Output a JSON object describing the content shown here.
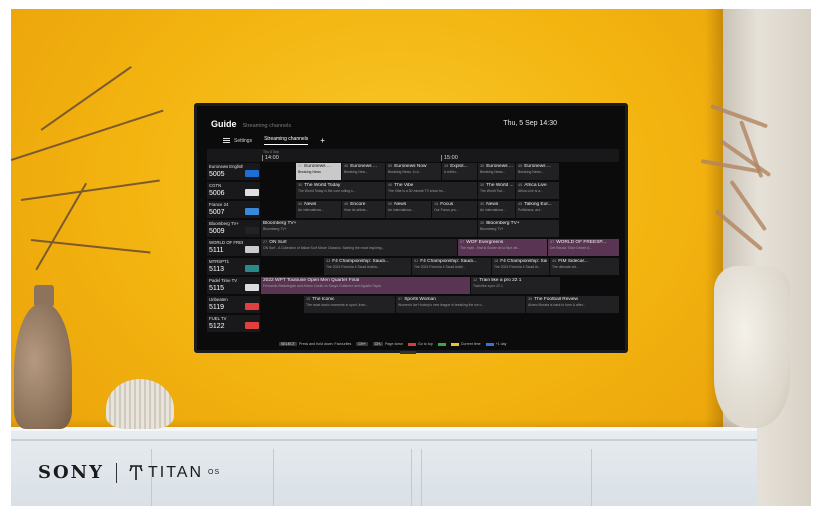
{
  "brand": {
    "sony": "SONY",
    "titan": "TITAN",
    "titan_sup": "OS"
  },
  "guide": {
    "title": "Guide",
    "subtitle": "Streaming channels",
    "clock": "Thu, 5 Sep 14:30",
    "tabs": [
      {
        "label": "Settings",
        "icon": "menu-icon"
      },
      {
        "label": "Streaming channels"
      }
    ],
    "add_tab": "+",
    "timeline": {
      "date": "Thu 5 Sep",
      "times": [
        "14:00",
        "15:00"
      ]
    }
  },
  "channels": [
    {
      "name": "Euronews English",
      "number": "5005",
      "logo_text": "euro",
      "logo_color": "#1d6fd6"
    },
    {
      "name": "CGTN",
      "number": "5006",
      "logo_text": "CGTN",
      "logo_color": "#e0e0e0"
    },
    {
      "name": "France 24",
      "number": "5007",
      "logo_text": "F24",
      "logo_color": "#3a88d8"
    },
    {
      "name": "Bloomberg TV+",
      "number": "5009",
      "logo_text": "BTV",
      "logo_color": "#222222"
    },
    {
      "name": "WORLD OF FREE...",
      "number": "5111",
      "logo_text": "WOF",
      "logo_color": "#cccccc"
    },
    {
      "name": "MTRSPT1",
      "number": "5113",
      "logo_text": "MT",
      "logo_color": "#2a8a8a"
    },
    {
      "name": "Padel Time TV",
      "number": "5115",
      "logo_text": "PTV",
      "logo_color": "#dddddd"
    },
    {
      "name": "Unbeaten",
      "number": "5119",
      "logo_text": "UNB",
      "logo_color": "#e04040"
    },
    {
      "name": "FUEL TV",
      "number": "5122",
      "logo_text": "FTV",
      "logo_color": "#e04040"
    }
  ],
  "programmes": [
    [
      {
        "num": "30",
        "title": "Euronews ...",
        "desc": "Breaking News",
        "selected": true
      },
      {
        "num": "45",
        "title": "Euronews ...",
        "desc": "Breaking New..."
      },
      {
        "num": "59",
        "title": "Euronews Now",
        "desc": "Breaking News. In d..."
      },
      {
        "num": "19",
        "title": "Explot...",
        "desc": "A rethin..."
      },
      {
        "num": "30",
        "title": "Euronews ...",
        "desc": "Breaking News..."
      },
      {
        "num": "45",
        "title": "Euronews ...",
        "desc": "Breaking News..."
      }
    ],
    [
      {
        "num": "30",
        "title": "The World Today",
        "desc": "The World Today is the core rolling s..."
      },
      {
        "num": "00",
        "title": "The Vibe",
        "desc": "The Vibe is a 30-minute TV show fro..."
      },
      {
        "num": "30",
        "title": "The World ...",
        "desc": "The World Tod..."
      },
      {
        "num": "45",
        "title": "Africa Live",
        "desc": "Africa Live is a..."
      }
    ],
    [
      {
        "num": "30",
        "title": "News",
        "desc": "An internationa..."
      },
      {
        "num": "45",
        "title": "Encore",
        "desc": "How do artists..."
      },
      {
        "num": "00",
        "title": "News",
        "desc": "An internationa..."
      },
      {
        "num": "15",
        "title": "Focus",
        "desc": "Our Focus pro..."
      },
      {
        "num": "30",
        "title": "News",
        "desc": "An internationa..."
      },
      {
        "num": "45",
        "title": "Talking Eur...",
        "desc": "Politicians, act..."
      }
    ],
    [
      {
        "num": "",
        "title": "Bloomberg TV+",
        "desc": "Bloomberg TV+"
      },
      {
        "num": "30",
        "title": "Bloomberg TV+",
        "desc": "Bloomberg TV+"
      }
    ],
    [
      {
        "num": "27",
        "title": "ON Surf",
        "desc": "ON Surf - A Collection of Italian Surf Movie Classics. Starting the most inspiring..."
      },
      {
        "num": "07",
        "title": "WOF Evergreens",
        "desc": "The myth - that is Sower de la Nue wit..."
      },
      {
        "num": "37",
        "title": "WORLD OF FREESP...",
        "desc": "Der Beuda Tölze Desert d..."
      }
    ],
    [
      {
        "num": "33",
        "title": "F4 Championship: Saudi...",
        "desc": "The 2024 Formula 4 Saudi Arabia..."
      },
      {
        "num": "51",
        "title": "F4 Championship: Saudi...",
        "desc": "The 2024 Formula 4 Saudi Arabi..."
      },
      {
        "num": "18",
        "title": "F4 Championship: Sau...",
        "desc": "The 2024 Formula 4 Saudi Ar..."
      },
      {
        "num": "44",
        "title": "FIM Sidecar...",
        "desc": "The ultimate sid..."
      }
    ],
    [
      {
        "num": "",
        "title": "2022 WPT Toulouse Open Men Quarter Final",
        "desc": "Fernando Belasteguin and Arturo Coello vs Sanyo Gutierrez and Agustin Tapia"
      },
      {
        "num": "12",
        "title": "Train like a pro 22 1",
        "desc": "Train like a pro 22 1"
      }
    ],
    [
      {
        "num": "15",
        "title": "The Iconic",
        "desc": "The most iconic moments in sport, from..."
      },
      {
        "num": "47",
        "title": "Sports Woman",
        "desc": "Women's Ice Hockey's new league is breaking the ice o..."
      },
      {
        "num": "30",
        "title": "The Football Review",
        "desc": "Alvaro Morata is back in form & after..."
      }
    ],
    []
  ],
  "legend": [
    {
      "key": "SELECT",
      "text": "Press and hold down: Favourites"
    },
    {
      "key": "CH+",
      "text": ""
    },
    {
      "key": "CH-",
      "text": "Page down"
    },
    {
      "color": "#e03a3a",
      "text": "Go to top"
    },
    {
      "color": "#3aa84a",
      "text": ""
    },
    {
      "color": "#e8c32e",
      "text": "Current time"
    },
    {
      "color": "#3a6fe0",
      "text": "+1 day"
    }
  ]
}
